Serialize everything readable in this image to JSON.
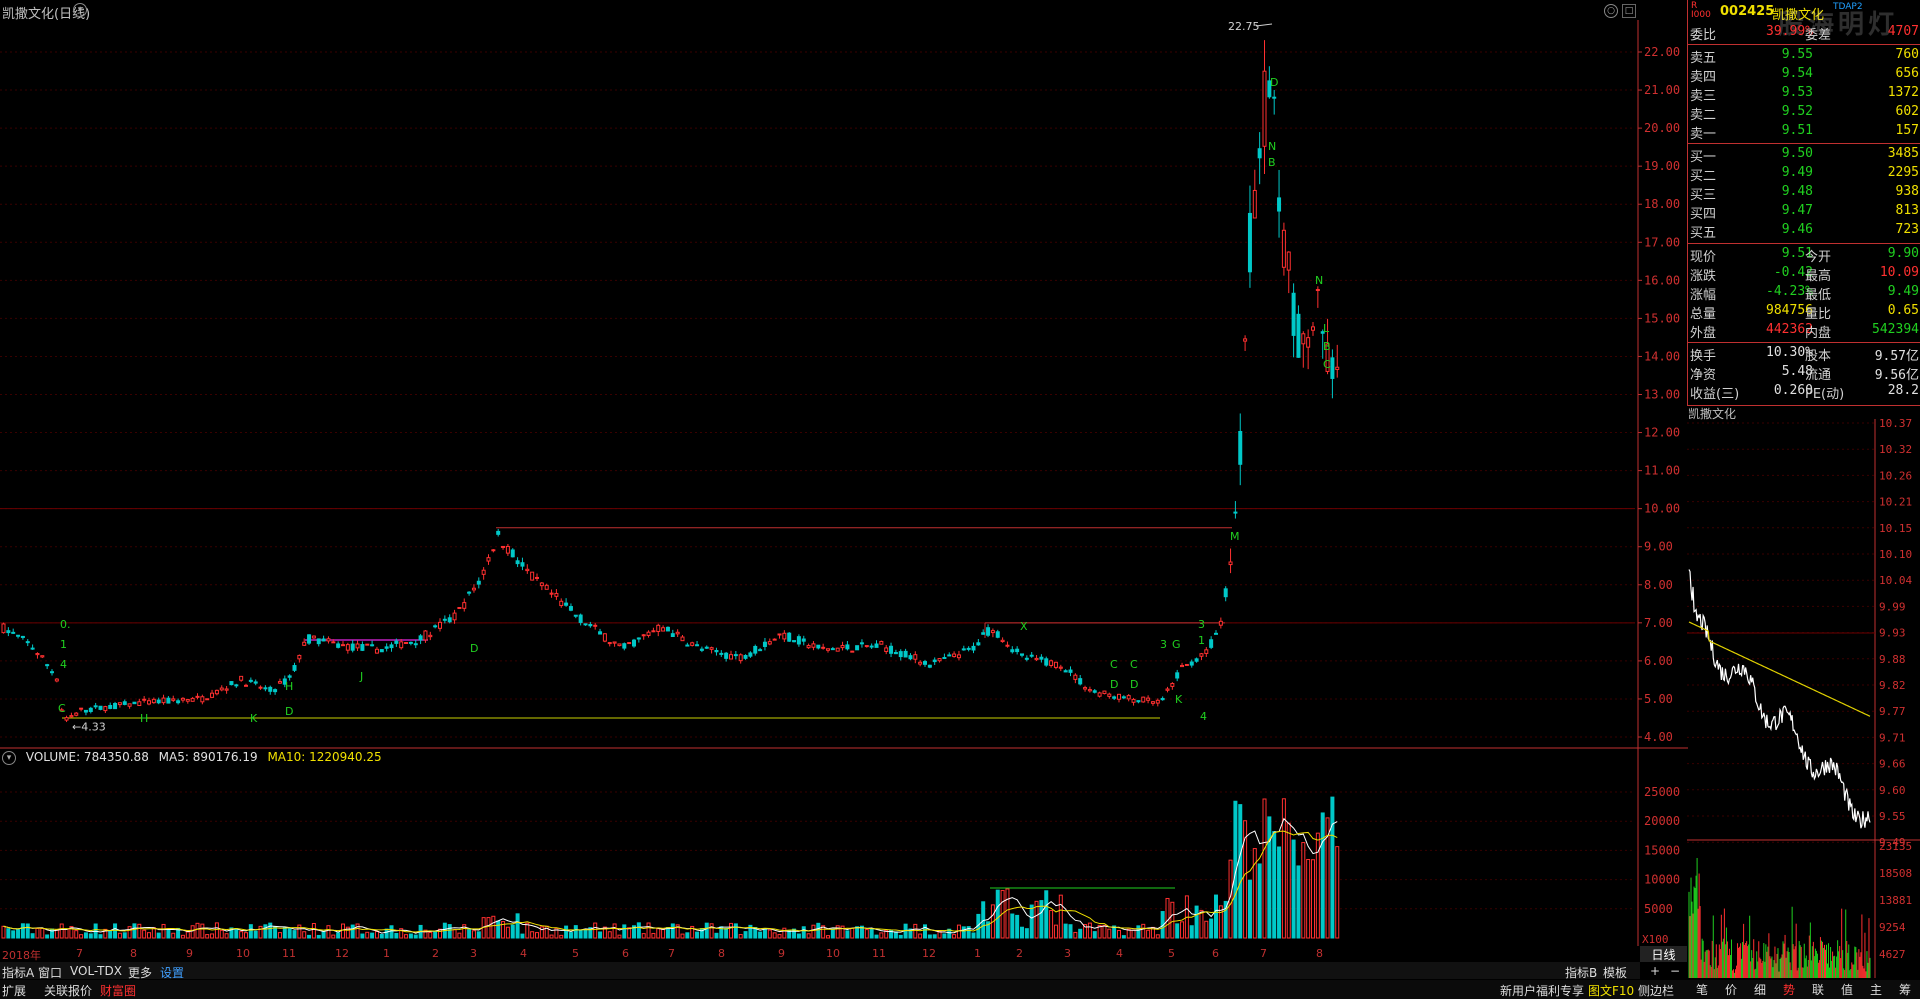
{
  "title": "凯撒文化(日线)",
  "price_axis": [
    "22.00",
    "21.00",
    "20.00",
    "19.00",
    "18.00",
    "17.00",
    "16.00",
    "15.00",
    "14.00",
    "13.00",
    "12.00",
    "11.00",
    "10.00",
    "9.00",
    "8.00",
    "7.00",
    "6.00",
    "5.00",
    "4.00"
  ],
  "peak_label": "22.75",
  "low_label": "4.33",
  "volume_header": {
    "volume": "VOLUME: 784350.88",
    "ma5": "MA5: 890176.19",
    "ma10": "MA10: 1220940.25"
  },
  "volume_axis": [
    "25000",
    "20000",
    "15000",
    "10000",
    "5000",
    "X100"
  ],
  "date_axis": [
    "2018年",
    "7",
    "8",
    "9",
    "10",
    "11",
    "12",
    "1",
    "2",
    "3",
    "4",
    "5",
    "6",
    "7",
    "8",
    "9",
    "10",
    "11",
    "12",
    "1",
    "2",
    "3",
    "4",
    "5",
    "6",
    "7",
    "8"
  ],
  "period_btn": "日线",
  "bottom_tabs1": [
    "指标A",
    "窗口",
    "VOL-TDX",
    "更多",
    "设置"
  ],
  "bottom_tabs1_right": [
    "指标B",
    "模板",
    "+",
    "−"
  ],
  "bottom_tabs2": [
    "扩展",
    "关联报价",
    "财富圈"
  ],
  "bottom_tabs2_right": [
    "新用户福利专享",
    "图文F10",
    "侧边栏"
  ],
  "quote": {
    "code": "002425",
    "name": "凯撒文化",
    "tag": "TDAP2",
    "r_label": "R",
    "r_sub": "I000",
    "weibi_label": "委比",
    "weibi": "39.99%",
    "weicha_label": "委差",
    "weicha": "4707",
    "asks": [
      {
        "label": "卖五",
        "price": "9.55",
        "vol": "760"
      },
      {
        "label": "卖四",
        "price": "9.54",
        "vol": "656"
      },
      {
        "label": "卖三",
        "price": "9.53",
        "vol": "1372"
      },
      {
        "label": "卖二",
        "price": "9.52",
        "vol": "602"
      },
      {
        "label": "卖一",
        "price": "9.51",
        "vol": "157"
      }
    ],
    "bids": [
      {
        "label": "买一",
        "price": "9.50",
        "vol": "3485"
      },
      {
        "label": "买二",
        "price": "9.49",
        "vol": "2295"
      },
      {
        "label": "买三",
        "price": "9.48",
        "vol": "938"
      },
      {
        "label": "买四",
        "price": "9.47",
        "vol": "813"
      },
      {
        "label": "买五",
        "price": "9.46",
        "vol": "723"
      }
    ],
    "stats": [
      {
        "l1": "现价",
        "v1": "9.51",
        "c1": "green",
        "l2": "今开",
        "v2": "9.90",
        "c2": "green"
      },
      {
        "l1": "涨跌",
        "v1": "-0.42",
        "c1": "green",
        "l2": "最高",
        "v2": "10.09",
        "c2": "red"
      },
      {
        "l1": "涨幅",
        "v1": "-4.23%",
        "c1": "green",
        "l2": "最低",
        "v2": "9.49",
        "c2": "green"
      },
      {
        "l1": "总量",
        "v1": "984756",
        "c1": "yellow",
        "l2": "量比",
        "v2": "0.65",
        "c2": "yellow"
      },
      {
        "l1": "外盘",
        "v1": "442362",
        "c1": "red",
        "l2": "内盘",
        "v2": "542394",
        "c2": "green"
      }
    ],
    "stats2": [
      {
        "l1": "换手",
        "v1": "10.30%",
        "l2": "股本",
        "v2": "9.57亿"
      },
      {
        "l1": "净资",
        "v1": "5.48",
        "l2": "流通",
        "v2": "9.56亿"
      },
      {
        "l1": "收益(三)",
        "v1": "0.260",
        "l2": "PE(动)",
        "v2": "28.2"
      }
    ]
  },
  "intraday": {
    "title": "凯撒文化",
    "price_axis": [
      "10.37",
      "10.32",
      "10.26",
      "10.21",
      "10.15",
      "10.10",
      "10.04",
      "9.99",
      "9.93",
      "9.88",
      "9.82",
      "9.77",
      "9.71",
      "9.66",
      "9.60",
      "9.55",
      "9.49"
    ],
    "vol_axis": [
      "23135",
      "18508",
      "13881",
      "9254",
      "4627"
    ]
  },
  "side_tabs": [
    "笔",
    "价",
    "细",
    "势",
    "联",
    "值",
    "主",
    "筹"
  ],
  "watermark": "股海明灯",
  "colors": {
    "up": "#ff3030",
    "down": "#00c8c8",
    "ma5": "#ffffff",
    "ma10": "#f0e000",
    "grid": "#5a0000",
    "signal": "#20d020"
  }
}
